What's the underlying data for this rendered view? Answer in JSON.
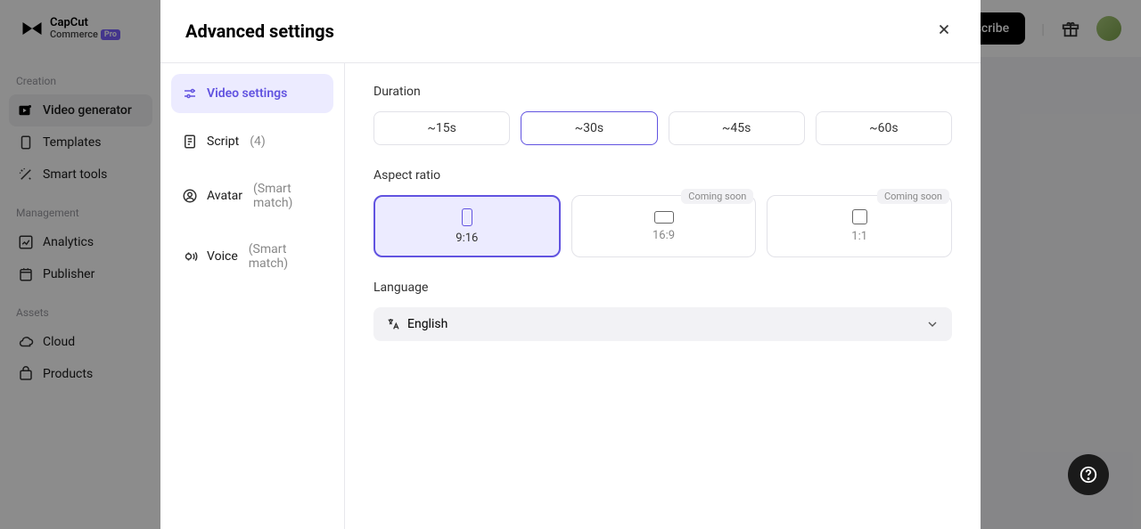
{
  "header": {
    "brand_top": "CapCut",
    "brand_sub": "Commerce",
    "brand_tag": "Pro",
    "subscribe_label": "Subscribe"
  },
  "sidebar": {
    "sections": {
      "creation": "Creation",
      "management": "Management",
      "assets": "Assets"
    },
    "items": {
      "video_generator": "Video generator",
      "templates": "Templates",
      "smart_tools": "Smart tools",
      "analytics": "Analytics",
      "publisher": "Publisher",
      "cloud": "Cloud",
      "products": "Products"
    }
  },
  "modal": {
    "title": "Advanced settings",
    "nav": {
      "video_settings": "Video settings",
      "script": "Script",
      "script_count": "(4)",
      "avatar": "Avatar",
      "avatar_meta": "(Smart match)",
      "voice": "Voice",
      "voice_meta": "(Smart match)"
    },
    "duration": {
      "label": "Duration",
      "options": [
        "~15s",
        "~30s",
        "~45s",
        "~60s"
      ],
      "selected": "~30s"
    },
    "aspect": {
      "label": "Aspect ratio",
      "options": {
        "portrait": "9:16",
        "landscape": "16:9",
        "square": "1:1"
      },
      "coming_soon": "Coming soon",
      "selected": "9:16"
    },
    "language": {
      "label": "Language",
      "value": "English"
    }
  }
}
